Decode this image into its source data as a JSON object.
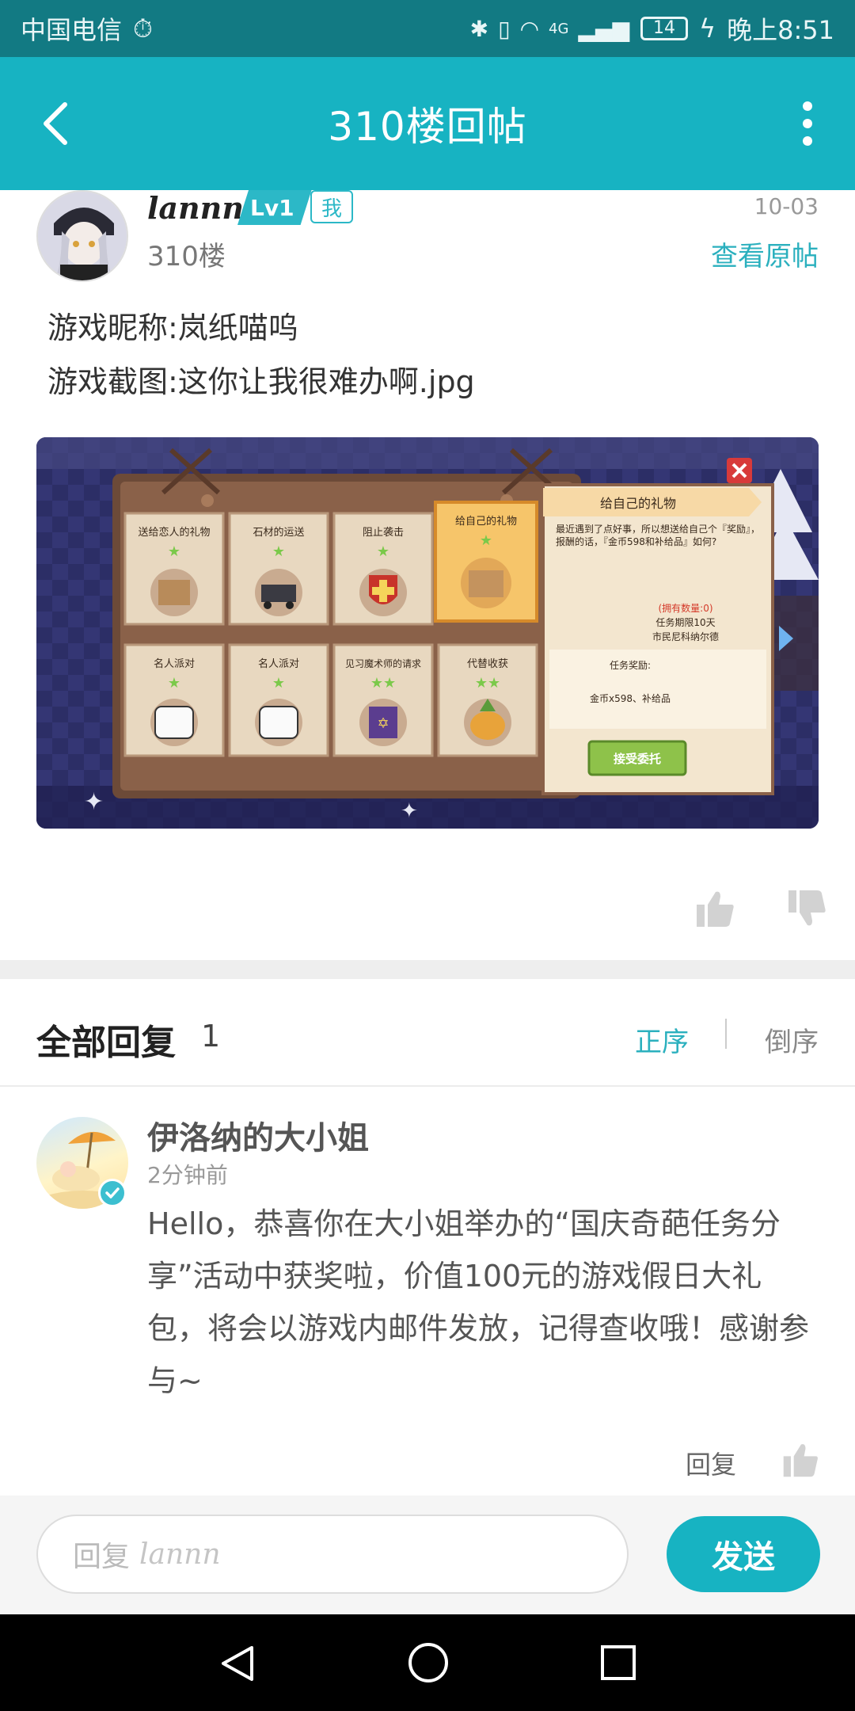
{
  "status": {
    "carrier": "中国电信",
    "network": "4G",
    "battery": "14",
    "time": "晚上8:51"
  },
  "appbar": {
    "title": "310楼回帖"
  },
  "post": {
    "author": "lannn",
    "level": "Lv1",
    "me_badge": "我",
    "date": "10-03",
    "floor": "310楼",
    "view_original": "查看原帖",
    "lines": [
      "游戏昵称:岚纸喵呜",
      "游戏截图:这你让我很难办啊.jpg"
    ],
    "screenshot": {
      "quest_cards": [
        {
          "title": "送给恋人的礼物",
          "stars": 1
        },
        {
          "title": "石材的运送",
          "stars": 1
        },
        {
          "title": "阻止袭击",
          "stars": 1
        },
        {
          "title": "给自己的礼物",
          "stars": 1
        },
        {
          "title": "名人派对",
          "stars": 1
        },
        {
          "title": "名人派对",
          "stars": 1
        },
        {
          "title": "见习魔术师的请求",
          "stars": 2
        },
        {
          "title": "代替收获",
          "stars": 2
        }
      ],
      "detail_title": "给自己的礼物",
      "detail_desc": "最近遇到了点好事，所以想送给自己个『奖励』，报酬的话，『金币598和补给品』如何?",
      "own_count": "(拥有数量:0)",
      "deadline": "任务期限10天",
      "client": "市民尼科纳尔德",
      "reward_label": "任务奖励:",
      "reward": "金币x598、补给品",
      "accept": "接受委托"
    }
  },
  "replies": {
    "title": "全部回复",
    "count": "1",
    "sort_asc": "正序",
    "sort_desc": "倒序",
    "items": [
      {
        "user": "伊洛纳的大小姐",
        "time": "2分钟前",
        "text": "Hello，恭喜你在大小姐举办的“国庆奇葩任务分享”活动中获奖啦，价值100元的游戏假日大礼包，将会以游戏内邮件发放，记得查收哦！感谢参与~",
        "reply_label": "回复"
      }
    ]
  },
  "composer": {
    "placeholder": "回复",
    "reply_to": "lannn",
    "send": "发送"
  },
  "colors": {
    "accent": "#17b3c2",
    "status_bar": "#127a83"
  }
}
